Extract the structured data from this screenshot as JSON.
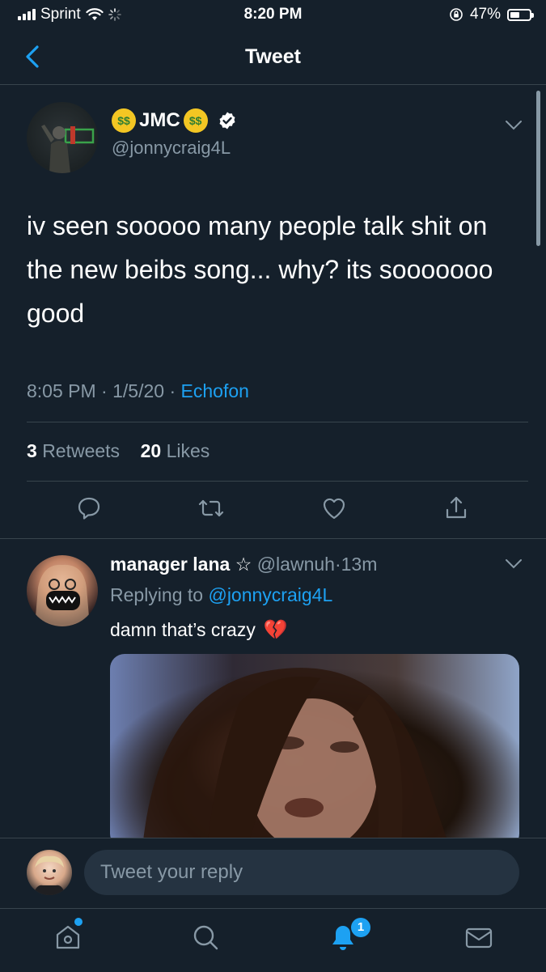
{
  "status_bar": {
    "carrier": "Sprint",
    "time": "8:20 PM",
    "battery": "47%"
  },
  "header": {
    "title": "Tweet"
  },
  "tweet": {
    "display_name": "JMC",
    "handle": "@jonnycraig4L",
    "text": "iv seen sooooo many people talk shit on the new beibs song... why? its sooooooo good",
    "time": "8:05 PM",
    "date": "1/5/20",
    "source": "Echofon",
    "sep": "·",
    "retweets_count": "3",
    "retweets_label": "Retweets",
    "likes_count": "20",
    "likes_label": "Likes"
  },
  "reply": {
    "name": "manager lana",
    "star": "☆",
    "handle": "@lawnuh",
    "sep": "·",
    "age": "13m",
    "replying_label": "Replying to",
    "replying_handle": "@jonnycraig4L",
    "text": "damn that’s crazy",
    "emoji": "💔"
  },
  "composer": {
    "placeholder": "Tweet your reply"
  },
  "tabs": {
    "notifications_badge": "1"
  },
  "colors": {
    "background": "#15202b",
    "accent": "#1da1f2",
    "muted": "#8899a6",
    "divider": "#38444d"
  },
  "icons": [
    "back-chevron-icon",
    "verified-badge-icon",
    "chevron-down-icon",
    "reply-icon",
    "retweet-icon",
    "like-icon",
    "share-icon",
    "home-icon",
    "search-icon",
    "notifications-icon",
    "messages-icon"
  ]
}
